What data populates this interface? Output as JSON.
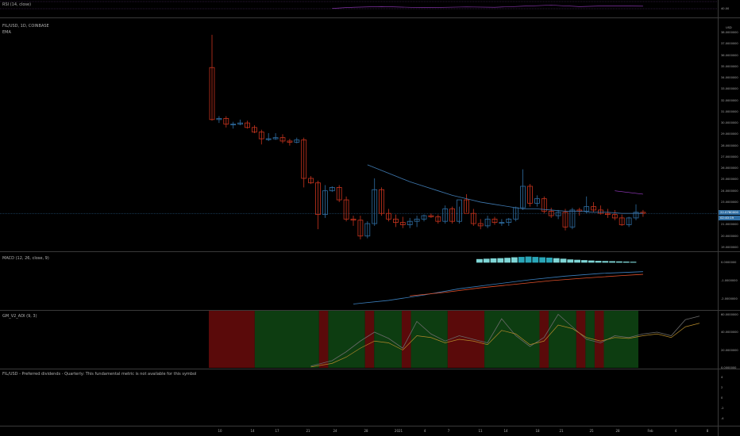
{
  "colors": {
    "up": "#2f6ea3",
    "down": "#c8341e",
    "ema": "#3f79b0",
    "macd_line": "#3b7fbd",
    "signal_line": "#e0502a",
    "hist": "#7fd6d6",
    "rsi": "#9c3cc8",
    "bull_bg": "#0d3d11",
    "bear_bg": "#5a0a0a"
  },
  "rsi_pane": {
    "title": "RSI (14, close)",
    "tick": "40.00"
  },
  "price_pane": {
    "title": "FIL/USD, 1D, COINBASE",
    "subtitle": "EMA",
    "currency": "USD",
    "last_price_badge": "22.0780000",
    "countdown_badge": "02:40:19",
    "ticks": [
      "38.0000000",
      "37.0000000",
      "36.0000000",
      "35.0000000",
      "34.0000000",
      "33.0000000",
      "32.0000000",
      "31.0000000",
      "30.0000000",
      "29.0000000",
      "28.0000000",
      "27.0000000",
      "26.0000000",
      "25.0000000",
      "24.0000000",
      "23.0000000",
      "22.0000000",
      "21.0000000",
      "20.0000000",
      "19.0000000"
    ]
  },
  "macd_pane": {
    "title": "MACD (12, 26, close, 9)",
    "ticks": [
      "0.0000000",
      "-1.0000000",
      "-2.0000000"
    ]
  },
  "gm_pane": {
    "title": "GM_V2_ADI (9, 3)",
    "ticks": [
      "60.0000000",
      "40.0000000",
      "20.0000000",
      "0.0000000"
    ]
  },
  "div_pane": {
    "title": "FIL/USD - Preferred dividends - Quarterly: This fundamental metric is not available for this symbol",
    "ticks": [
      "4",
      "2",
      "0",
      "-2",
      "-4"
    ]
  },
  "x_axis": {
    "labels": [
      "10",
      "14",
      "17",
      "21",
      "24",
      "28",
      "2021",
      "4",
      "7",
      "11",
      "14",
      "18",
      "21",
      "25",
      "28",
      "Feb",
      "4",
      "8"
    ]
  },
  "chart_data": {
    "type": "candlestick",
    "title": "FIL/USD, 1D, COINBASE",
    "ylim": [
      19,
      39
    ],
    "candles": [
      [
        34.9,
        37.8,
        30.2,
        30.3
      ],
      [
        30.3,
        30.6,
        30.0,
        30.4
      ],
      [
        30.4,
        30.6,
        29.6,
        29.9
      ],
      [
        29.9,
        30.1,
        29.5,
        29.9
      ],
      [
        29.9,
        30.3,
        29.8,
        30.0
      ],
      [
        30.0,
        30.2,
        29.5,
        29.6
      ],
      [
        29.6,
        29.8,
        29.1,
        29.2
      ],
      [
        29.2,
        29.4,
        28.1,
        28.6
      ],
      [
        28.6,
        29.1,
        28.4,
        28.6
      ],
      [
        28.6,
        29.1,
        28.5,
        28.7
      ],
      [
        28.7,
        29.0,
        28.2,
        28.4
      ],
      [
        28.4,
        28.6,
        28.0,
        28.3
      ],
      [
        28.3,
        28.7,
        28.2,
        28.5
      ],
      [
        28.5,
        28.7,
        24.3,
        25.1
      ],
      [
        25.1,
        25.3,
        24.6,
        24.7
      ],
      [
        24.7,
        24.9,
        20.6,
        21.9
      ],
      [
        21.9,
        24.5,
        21.6,
        24.0
      ],
      [
        24.0,
        24.4,
        23.9,
        24.3
      ],
      [
        24.3,
        24.5,
        23.0,
        23.2
      ],
      [
        23.2,
        23.5,
        21.3,
        21.5
      ],
      [
        21.5,
        21.8,
        20.9,
        21.4
      ],
      [
        21.4,
        21.8,
        19.7,
        20.0
      ],
      [
        20.0,
        21.3,
        19.8,
        21.1
      ],
      [
        21.1,
        25.1,
        20.9,
        24.1
      ],
      [
        24.1,
        24.3,
        21.8,
        22.0
      ],
      [
        22.0,
        22.4,
        21.3,
        21.5
      ],
      [
        21.5,
        21.9,
        20.8,
        21.2
      ],
      [
        21.2,
        21.7,
        20.7,
        21.0
      ],
      [
        21.0,
        21.6,
        20.7,
        21.3
      ],
      [
        21.3,
        21.8,
        20.8,
        21.5
      ],
      [
        21.5,
        21.9,
        21.3,
        21.8
      ],
      [
        21.8,
        22.0,
        21.6,
        21.7
      ],
      [
        21.7,
        21.9,
        21.1,
        21.3
      ],
      [
        21.3,
        22.7,
        21.1,
        22.4
      ],
      [
        22.4,
        22.6,
        21.1,
        21.3
      ],
      [
        21.3,
        22.6,
        21.1,
        23.2
      ],
      [
        23.2,
        23.7,
        22.1,
        22.0
      ],
      [
        22.0,
        22.4,
        20.9,
        21.1
      ],
      [
        21.1,
        21.5,
        20.6,
        20.9
      ],
      [
        20.9,
        21.8,
        20.7,
        21.5
      ],
      [
        21.5,
        21.7,
        21.0,
        21.2
      ],
      [
        21.2,
        21.5,
        20.9,
        21.2
      ],
      [
        21.2,
        21.6,
        20.9,
        21.5
      ],
      [
        21.5,
        22.6,
        21.3,
        22.5
      ],
      [
        22.5,
        25.9,
        22.3,
        24.4
      ],
      [
        24.4,
        24.6,
        22.6,
        22.9
      ],
      [
        22.9,
        23.6,
        22.6,
        23.3
      ],
      [
        23.3,
        23.5,
        22.0,
        22.2
      ],
      [
        22.2,
        22.5,
        21.6,
        21.8
      ],
      [
        21.8,
        22.3,
        21.5,
        22.1
      ],
      [
        22.1,
        22.4,
        20.5,
        20.8
      ],
      [
        20.8,
        22.5,
        20.6,
        22.3
      ],
      [
        22.3,
        22.5,
        21.8,
        22.2
      ],
      [
        22.2,
        23.5,
        22.0,
        22.6
      ],
      [
        22.6,
        23.0,
        22.1,
        22.3
      ],
      [
        22.3,
        22.7,
        21.9,
        22.0
      ],
      [
        22.0,
        22.4,
        21.6,
        21.9
      ],
      [
        21.9,
        22.3,
        21.4,
        21.6
      ],
      [
        21.6,
        21.9,
        20.9,
        21.0
      ],
      [
        21.0,
        21.7,
        20.8,
        21.6
      ],
      [
        21.6,
        22.8,
        21.4,
        22.1
      ],
      [
        22.1,
        22.3,
        21.7,
        22.0
      ]
    ],
    "ema": [
      [
        22,
        26.3
      ],
      [
        24,
        25.8
      ],
      [
        26,
        25.3
      ],
      [
        28,
        24.8
      ],
      [
        30,
        24.4
      ],
      [
        32,
        24.0
      ],
      [
        34,
        23.6
      ],
      [
        36,
        23.3
      ],
      [
        38,
        23.0
      ],
      [
        40,
        22.8
      ],
      [
        42,
        22.6
      ],
      [
        44,
        22.4
      ],
      [
        46,
        22.4
      ],
      [
        48,
        22.3
      ],
      [
        50,
        22.2
      ],
      [
        52,
        22.2
      ],
      [
        54,
        22.1
      ],
      [
        56,
        22.1
      ],
      [
        58,
        22.0
      ],
      [
        61,
        22.0
      ]
    ],
    "ema2": [
      [
        57,
        24.0
      ],
      [
        61,
        23.7
      ]
    ],
    "macd": [
      [
        20,
        -2.3
      ],
      [
        25,
        -2.1
      ],
      [
        30,
        -1.8
      ],
      [
        35,
        -1.45
      ],
      [
        40,
        -1.2
      ],
      [
        45,
        -0.95
      ],
      [
        50,
        -0.75
      ],
      [
        55,
        -0.6
      ],
      [
        61,
        -0.5
      ]
    ],
    "signal": [
      [
        28,
        -1.85
      ],
      [
        33,
        -1.65
      ],
      [
        38,
        -1.4
      ],
      [
        43,
        -1.2
      ],
      [
        48,
        -1.0
      ],
      [
        53,
        -0.85
      ],
      [
        58,
        -0.72
      ],
      [
        61,
        -0.65
      ]
    ],
    "hist": [
      0.2,
      0.22,
      0.24,
      0.25,
      0.27,
      0.3,
      0.32,
      0.34,
      0.32,
      0.3,
      0.28,
      0.25,
      0.22,
      0.18,
      0.16,
      0.14,
      0.12,
      0.1,
      0.09,
      0.08,
      0.07,
      0.06,
      0.05
    ],
    "regimes": [
      [
        0,
        "bear"
      ],
      [
        5,
        "bull"
      ],
      [
        12,
        "bear"
      ],
      [
        13,
        "bull"
      ],
      [
        17,
        "bear"
      ],
      [
        18,
        "bull"
      ],
      [
        21,
        "bear"
      ],
      [
        22,
        "bull"
      ],
      [
        26,
        "bear"
      ],
      [
        30,
        "bull"
      ],
      [
        36,
        "bear"
      ],
      [
        37,
        "bull"
      ],
      [
        40,
        "bear"
      ],
      [
        41,
        "bull"
      ],
      [
        42,
        "bear"
      ],
      [
        43,
        "bull"
      ]
    ],
    "gm_a": [
      [
        5,
        2
      ],
      [
        8,
        8
      ],
      [
        10,
        18
      ],
      [
        12,
        30
      ],
      [
        14,
        40
      ],
      [
        16,
        33
      ],
      [
        18,
        22
      ],
      [
        20,
        52
      ],
      [
        22,
        38
      ],
      [
        24,
        30
      ],
      [
        26,
        36
      ],
      [
        28,
        32
      ],
      [
        30,
        28
      ],
      [
        32,
        55
      ],
      [
        34,
        36
      ],
      [
        36,
        24
      ],
      [
        38,
        34
      ],
      [
        40,
        60
      ],
      [
        42,
        46
      ],
      [
        44,
        32
      ],
      [
        46,
        28
      ],
      [
        48,
        36
      ],
      [
        50,
        34
      ],
      [
        52,
        38
      ],
      [
        54,
        40
      ],
      [
        56,
        36
      ],
      [
        58,
        54
      ],
      [
        60,
        58
      ]
    ],
    "gm_b": [
      [
        5,
        1
      ],
      [
        8,
        5
      ],
      [
        10,
        12
      ],
      [
        12,
        22
      ],
      [
        14,
        30
      ],
      [
        16,
        28
      ],
      [
        18,
        20
      ],
      [
        20,
        36
      ],
      [
        22,
        34
      ],
      [
        24,
        28
      ],
      [
        26,
        32
      ],
      [
        28,
        30
      ],
      [
        30,
        26
      ],
      [
        32,
        42
      ],
      [
        34,
        38
      ],
      [
        36,
        26
      ],
      [
        38,
        30
      ],
      [
        40,
        48
      ],
      [
        42,
        44
      ],
      [
        44,
        34
      ],
      [
        46,
        30
      ],
      [
        48,
        34
      ],
      [
        50,
        33
      ],
      [
        52,
        36
      ],
      [
        54,
        38
      ],
      [
        56,
        34
      ],
      [
        58,
        46
      ],
      [
        60,
        50
      ]
    ],
    "rsi": [
      [
        17,
        41
      ],
      [
        20,
        44
      ],
      [
        24,
        46
      ],
      [
        30,
        43
      ],
      [
        36,
        45
      ],
      [
        40,
        44
      ],
      [
        44,
        47
      ],
      [
        48,
        50
      ],
      [
        52,
        46
      ],
      [
        56,
        48
      ],
      [
        61,
        47
      ]
    ]
  }
}
